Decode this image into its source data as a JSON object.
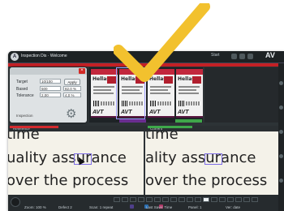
{
  "titlebar": {
    "app_icon": "inspection-app-logo",
    "title": "Inspection Dis · Welcome",
    "right_label": "Start"
  },
  "dialog": {
    "close": "×",
    "rows": [
      {
        "label": "Target",
        "value": "10/100",
        "extra": "Apply"
      },
      {
        "label": "Based",
        "value": "500",
        "extra": "82.0 %"
      },
      {
        "label": "Tolerance",
        "value": "2,00",
        "extra": "4,0 %"
      }
    ],
    "footer": "Inspection",
    "gear_icon": "gear-icon"
  },
  "thumbnails": [
    {
      "title": "Hellas",
      "brand": "AVT"
    },
    {
      "title": "Hellas",
      "brand": "AVT"
    },
    {
      "title": "Hellas",
      "brand": "AVT"
    },
    {
      "title": "Hellas",
      "brand": "AVT"
    }
  ],
  "zoom": {
    "headers": {
      "left": "Reference",
      "right": "Current"
    },
    "left_lines": [
      "time",
      "uality assurance",
      "over the process"
    ],
    "right_lines": [
      "time",
      "ality assurance",
      "over the process"
    ]
  },
  "statusbar": {
    "items": [
      "Zoom: 100 %",
      "Defect 2",
      "Scan: 1 repeat",
      "Last Save: Time",
      "Panel: 1",
      "Ver: date"
    ]
  },
  "colors": {
    "checkmark": "#f2c12e",
    "accent_red": "#c42025",
    "accent_purple": "#6a2d90",
    "accent_green": "#3fa64a"
  }
}
